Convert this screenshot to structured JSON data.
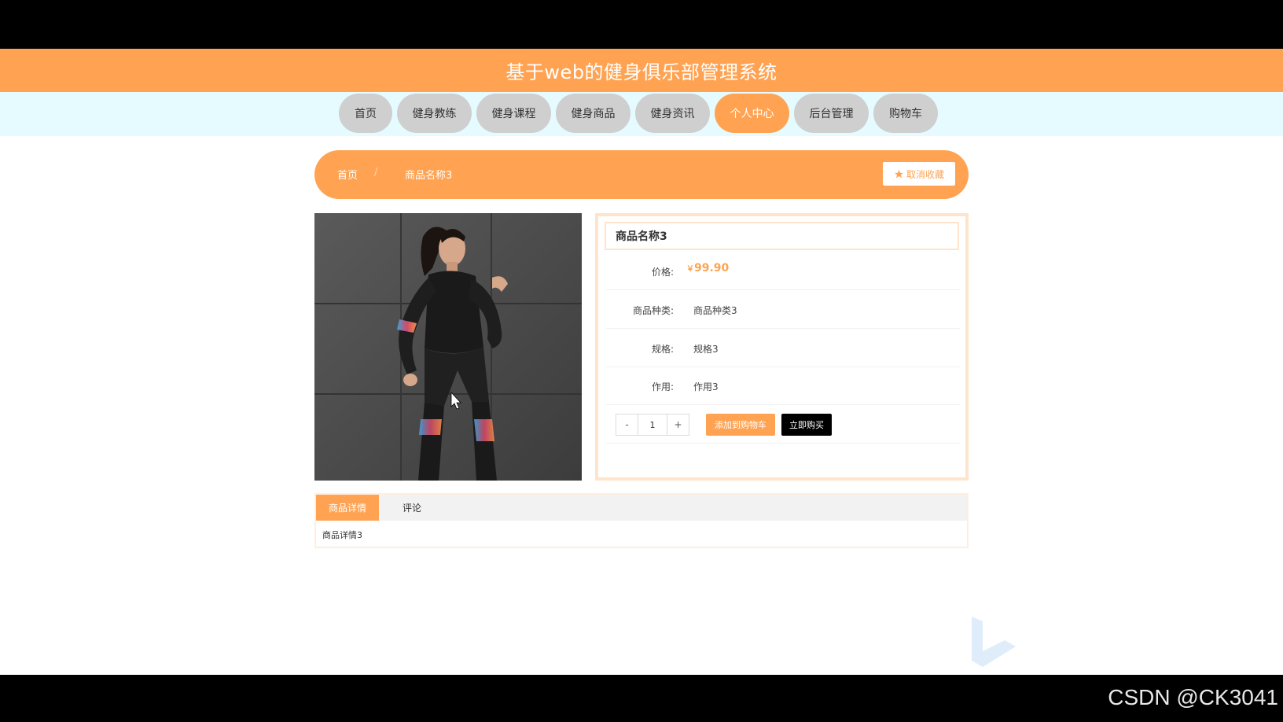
{
  "header": {
    "title": "基于web的健身俱乐部管理系统"
  },
  "nav": {
    "items": [
      {
        "label": "首页"
      },
      {
        "label": "健身教练"
      },
      {
        "label": "健身课程"
      },
      {
        "label": "健身商品"
      },
      {
        "label": "健身资讯"
      },
      {
        "label": "个人中心"
      },
      {
        "label": "后台管理"
      },
      {
        "label": "购物车"
      }
    ],
    "active_item": "个人中心"
  },
  "breadcrumb": {
    "home": "首页",
    "separator": "/",
    "current": "商品名称3",
    "favorite_label": "取消收藏"
  },
  "product": {
    "title": "商品名称3",
    "price_label": "价格:",
    "price_symbol": "￥",
    "price": "99.90",
    "category_label": "商品种类:",
    "category": "商品种类3",
    "spec_label": "规格:",
    "spec": "规格3",
    "effect_label": "作用:",
    "effect": "作用3",
    "quantity": "1",
    "minus_label": "-",
    "plus_label": "+",
    "add_cart_label": "添加到购物车",
    "buy_now_label": "立即购买"
  },
  "tabs": {
    "items": [
      {
        "label": "商品详情"
      },
      {
        "label": "评论"
      }
    ],
    "content": "商品详情3"
  },
  "watermark": "CSDN @CK3041",
  "colors": {
    "accent": "#ffa352",
    "nav_bg": "#e6fbff",
    "nav_inactive": "#cfcfcf"
  }
}
